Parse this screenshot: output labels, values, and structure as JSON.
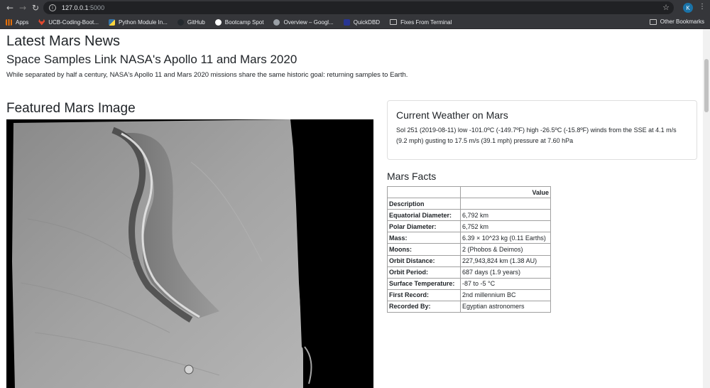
{
  "browser": {
    "url_host": "127.0.0.1",
    "url_port": ":5000",
    "profile_initial": "K",
    "bookmarks": [
      {
        "label": "Apps",
        "color": "#e8710a"
      },
      {
        "label": "UCB-Coding-Boot...",
        "color": "#e2492f"
      },
      {
        "label": "Python Module In...",
        "color": "#3572a5"
      },
      {
        "label": "GitHub",
        "color": "#24292e"
      },
      {
        "label": "Bootcamp Spot",
        "color": "#ffffff"
      },
      {
        "label": "Overview – Googl...",
        "color": "#9aa0a6"
      },
      {
        "label": "QuickDBD",
        "color": "#283593"
      },
      {
        "label": "Fixes From Terminal",
        "color": "#c8c8c8"
      }
    ],
    "other_bookmarks": "Other Bookmarks"
  },
  "news": {
    "heading": "Latest Mars News",
    "title": "Space Samples Link NASA's Apollo 11 and Mars 2020",
    "teaser": "While separated by half a century, NASA's Apollo 11 and Mars 2020 missions share the same historic goal: returning samples to Earth."
  },
  "featured": {
    "heading": "Featured Mars Image"
  },
  "weather": {
    "heading": "Current Weather on Mars",
    "text": "Sol 251 (2019-08-11) low -101.0ºC (-149.7ºF) high -26.5ºC (-15.8ºF) winds from the SSE at 4.1 m/s (9.2 mph) gusting to 17.5 m/s (39.1 mph) pressure at 7.60 hPa"
  },
  "facts": {
    "heading": "Mars Facts",
    "value_header": "Value",
    "description_header": "Description",
    "rows": [
      {
        "key": "Equatorial Diameter:",
        "value": "6,792 km"
      },
      {
        "key": "Polar Diameter:",
        "value": "6,752 km"
      },
      {
        "key": "Mass:",
        "value": "6.39 × 10^23 kg (0.11 Earths)"
      },
      {
        "key": "Moons:",
        "value": "2 (Phobos & Deimos)"
      },
      {
        "key": "Orbit Distance:",
        "value": "227,943,824 km (1.38 AU)"
      },
      {
        "key": "Orbit Period:",
        "value": "687 days (1.9 years)"
      },
      {
        "key": "Surface Temperature:",
        "value": "-87 to -5 °C"
      },
      {
        "key": "First Record:",
        "value": "2nd millennium BC"
      },
      {
        "key": "Recorded By:",
        "value": "Egyptian astronomers"
      }
    ]
  }
}
